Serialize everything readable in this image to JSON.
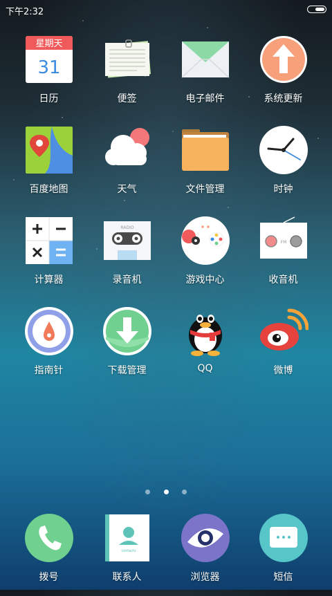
{
  "status": {
    "time": "下午2:32"
  },
  "calendar": {
    "weekday": "星期天",
    "day": "31"
  },
  "apps": [
    {
      "id": "calendar",
      "label": "日历"
    },
    {
      "id": "notes",
      "label": "便签"
    },
    {
      "id": "email",
      "label": "电子邮件"
    },
    {
      "id": "update",
      "label": "系统更新"
    },
    {
      "id": "maps",
      "label": "百度地图"
    },
    {
      "id": "weather",
      "label": "天气"
    },
    {
      "id": "files",
      "label": "文件管理"
    },
    {
      "id": "clock",
      "label": "时钟"
    },
    {
      "id": "calculator",
      "label": "计算器"
    },
    {
      "id": "recorder",
      "label": "录音机"
    },
    {
      "id": "games",
      "label": "游戏中心"
    },
    {
      "id": "radio",
      "label": "收音机"
    },
    {
      "id": "compass",
      "label": "指南针"
    },
    {
      "id": "downloads",
      "label": "下载管理"
    },
    {
      "id": "qq",
      "label": "QQ"
    },
    {
      "id": "weibo",
      "label": "微博"
    }
  ],
  "recorder_text": "RADIO",
  "radio_text": "FM",
  "contacts_text": "contacts",
  "dock": [
    {
      "id": "phone",
      "label": "拨号"
    },
    {
      "id": "contacts",
      "label": "联系人"
    },
    {
      "id": "browser",
      "label": "浏览器"
    },
    {
      "id": "sms",
      "label": "短信"
    }
  ],
  "pages": {
    "count": 3,
    "current": 2
  },
  "colors": {
    "accent_update": "#f7a07a",
    "email_green": "#8cd9a6",
    "phone_green": "#6fd08f",
    "browser_purple": "#7b74c9",
    "sms_teal": "#56c6c8",
    "calendar_red": "#f05a5a"
  }
}
